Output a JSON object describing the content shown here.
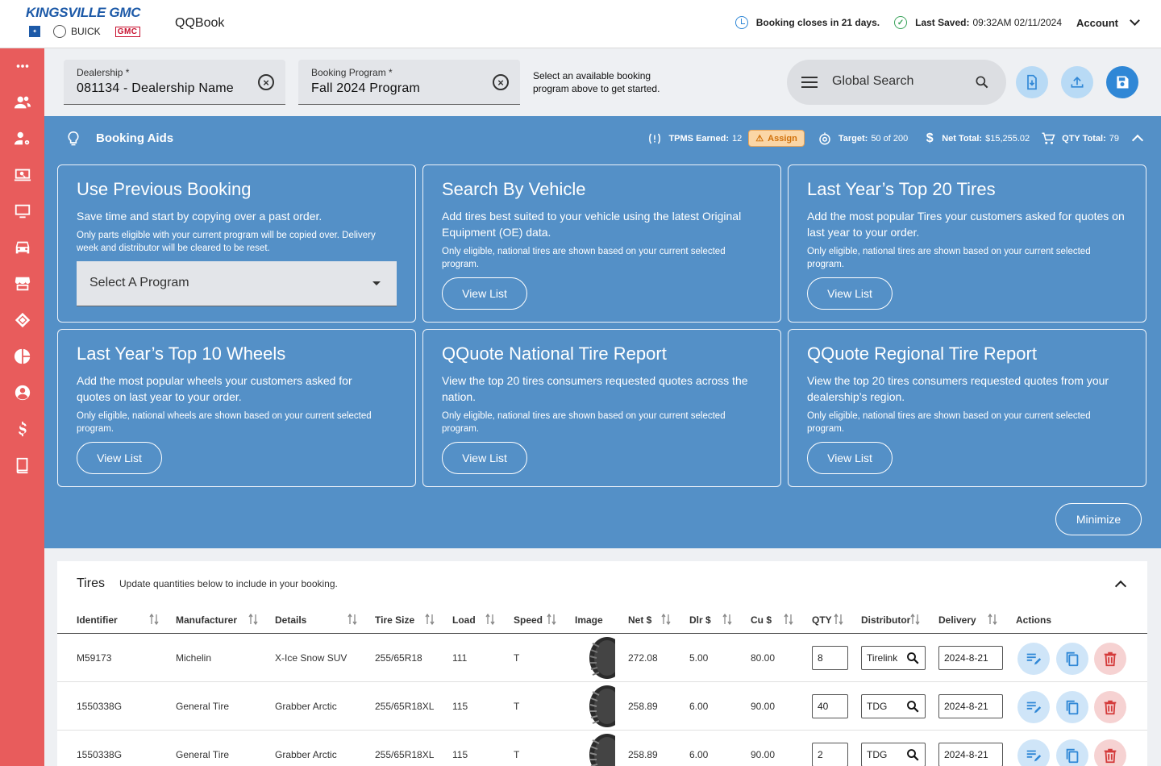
{
  "header": {
    "logo_main": "KINGSVILLE GMC",
    "logo_brand_buick": "BUICK",
    "logo_brand_gmc": "GMC",
    "app_name": "QQBook",
    "booking_closes": "Booking closes in 21 days.",
    "last_saved_label": "Last Saved:",
    "last_saved_value": "09:32AM 02/11/2024",
    "account_label": "Account"
  },
  "sidebar": {
    "items": [
      "more",
      "customers",
      "user-settings",
      "search-monitor",
      "monitor",
      "vehicle",
      "store",
      "tires",
      "reports",
      "profile",
      "billing",
      "catalog"
    ]
  },
  "filters": {
    "dealership_label": "Dealership *",
    "dealership_value": "081134 - Dealership Name",
    "program_label": "Booking Program *",
    "program_value": "Fall 2024 Program",
    "hint": "Select an available booking program above to get started.",
    "global_search_placeholder": "Global Search"
  },
  "booking_aids": {
    "title": "Booking Aids",
    "tpms_label": "TPMS Earned:",
    "tpms_value": "12",
    "assign_label": "Assign",
    "target_label": "Target:",
    "target_value": "50 of 200",
    "net_total_label": "Net Total:",
    "net_total_value": "$15,255.02",
    "qty_total_label": "QTY Total:",
    "qty_total_value": "79",
    "minimize_label": "Minimize",
    "cards": [
      {
        "title": "Use Previous Booking",
        "desc": "Save time and start by copying over a past order.",
        "note": "Only parts eligible with your current program will be copied over. Delivery week and distributor will be cleared to be reset.",
        "select_placeholder": "Select A Program"
      },
      {
        "title": "Search By Vehicle",
        "desc": "Add tires best suited to your vehicle using the latest Original Equipment (OE) data.",
        "note": "Only eligible, national tires are shown based on your current selected program.",
        "button": "View List"
      },
      {
        "title": "Last Year’s Top 20 Tires",
        "desc": "Add the most popular Tires your customers asked for quotes on last year to your order.",
        "note": "Only eligible, national tires are shown based on your current selected program.",
        "button": "View List"
      },
      {
        "title": "Last Year’s Top 10 Wheels",
        "desc": "Add the most popular wheels your customers asked for quotes on last year to your order.",
        "note": "Only eligible, national wheels are shown based on your current selected program.",
        "button": "View List"
      },
      {
        "title": "QQuote National Tire Report",
        "desc": "View the top 20 tires consumers requested quotes across the nation.",
        "note": "Only eligible, national tires are shown based on your current selected program.",
        "button": "View List"
      },
      {
        "title": "QQuote Regional Tire Report",
        "desc": "View the top 20 tires consumers requested quotes from your dealership’s region.",
        "note": "Only eligible, national tires are shown based on your current selected program.",
        "button": "View List"
      }
    ]
  },
  "tires": {
    "title": "Tires",
    "subtitle": "Update quantities below to include in your booking.",
    "columns": [
      "Identifier",
      "Manufacturer",
      "Details",
      "Tire Size",
      "Load",
      "Speed",
      "Image",
      "Net $",
      "Dlr $",
      "Cu $",
      "QTY",
      "Distributor",
      "Delivery",
      "Actions"
    ],
    "rows": [
      {
        "identifier": "M59173",
        "manufacturer": "Michelin",
        "details": "X-Ice Snow SUV",
        "size": "255/65R18",
        "load": "111",
        "speed": "T",
        "net": "272.08",
        "dlr": "5.00",
        "cu": "80.00",
        "qty": "8",
        "distributor": "Tirelink",
        "delivery": "2024-8-21"
      },
      {
        "identifier": "1550338G",
        "manufacturer": "General Tire",
        "details": "Grabber Arctic",
        "size": "255/65R18XL",
        "load": "115",
        "speed": "T",
        "net": "258.89",
        "dlr": "6.00",
        "cu": "90.00",
        "qty": "40",
        "distributor": "TDG",
        "delivery": "2024-8-21"
      },
      {
        "identifier": "1550338G",
        "manufacturer": "General Tire",
        "details": "Grabber Arctic",
        "size": "255/65R18XL",
        "load": "115",
        "speed": "T",
        "net": "258.89",
        "dlr": "6.00",
        "cu": "90.00",
        "qty": "2",
        "distributor": "TDG",
        "delivery": "2024-8-21"
      }
    ]
  },
  "colors": {
    "sidebar": "#e85c5c",
    "aids_bg": "#5490c7",
    "primary_blue": "#2f87d6",
    "assign_bg": "#fbd6a6"
  }
}
